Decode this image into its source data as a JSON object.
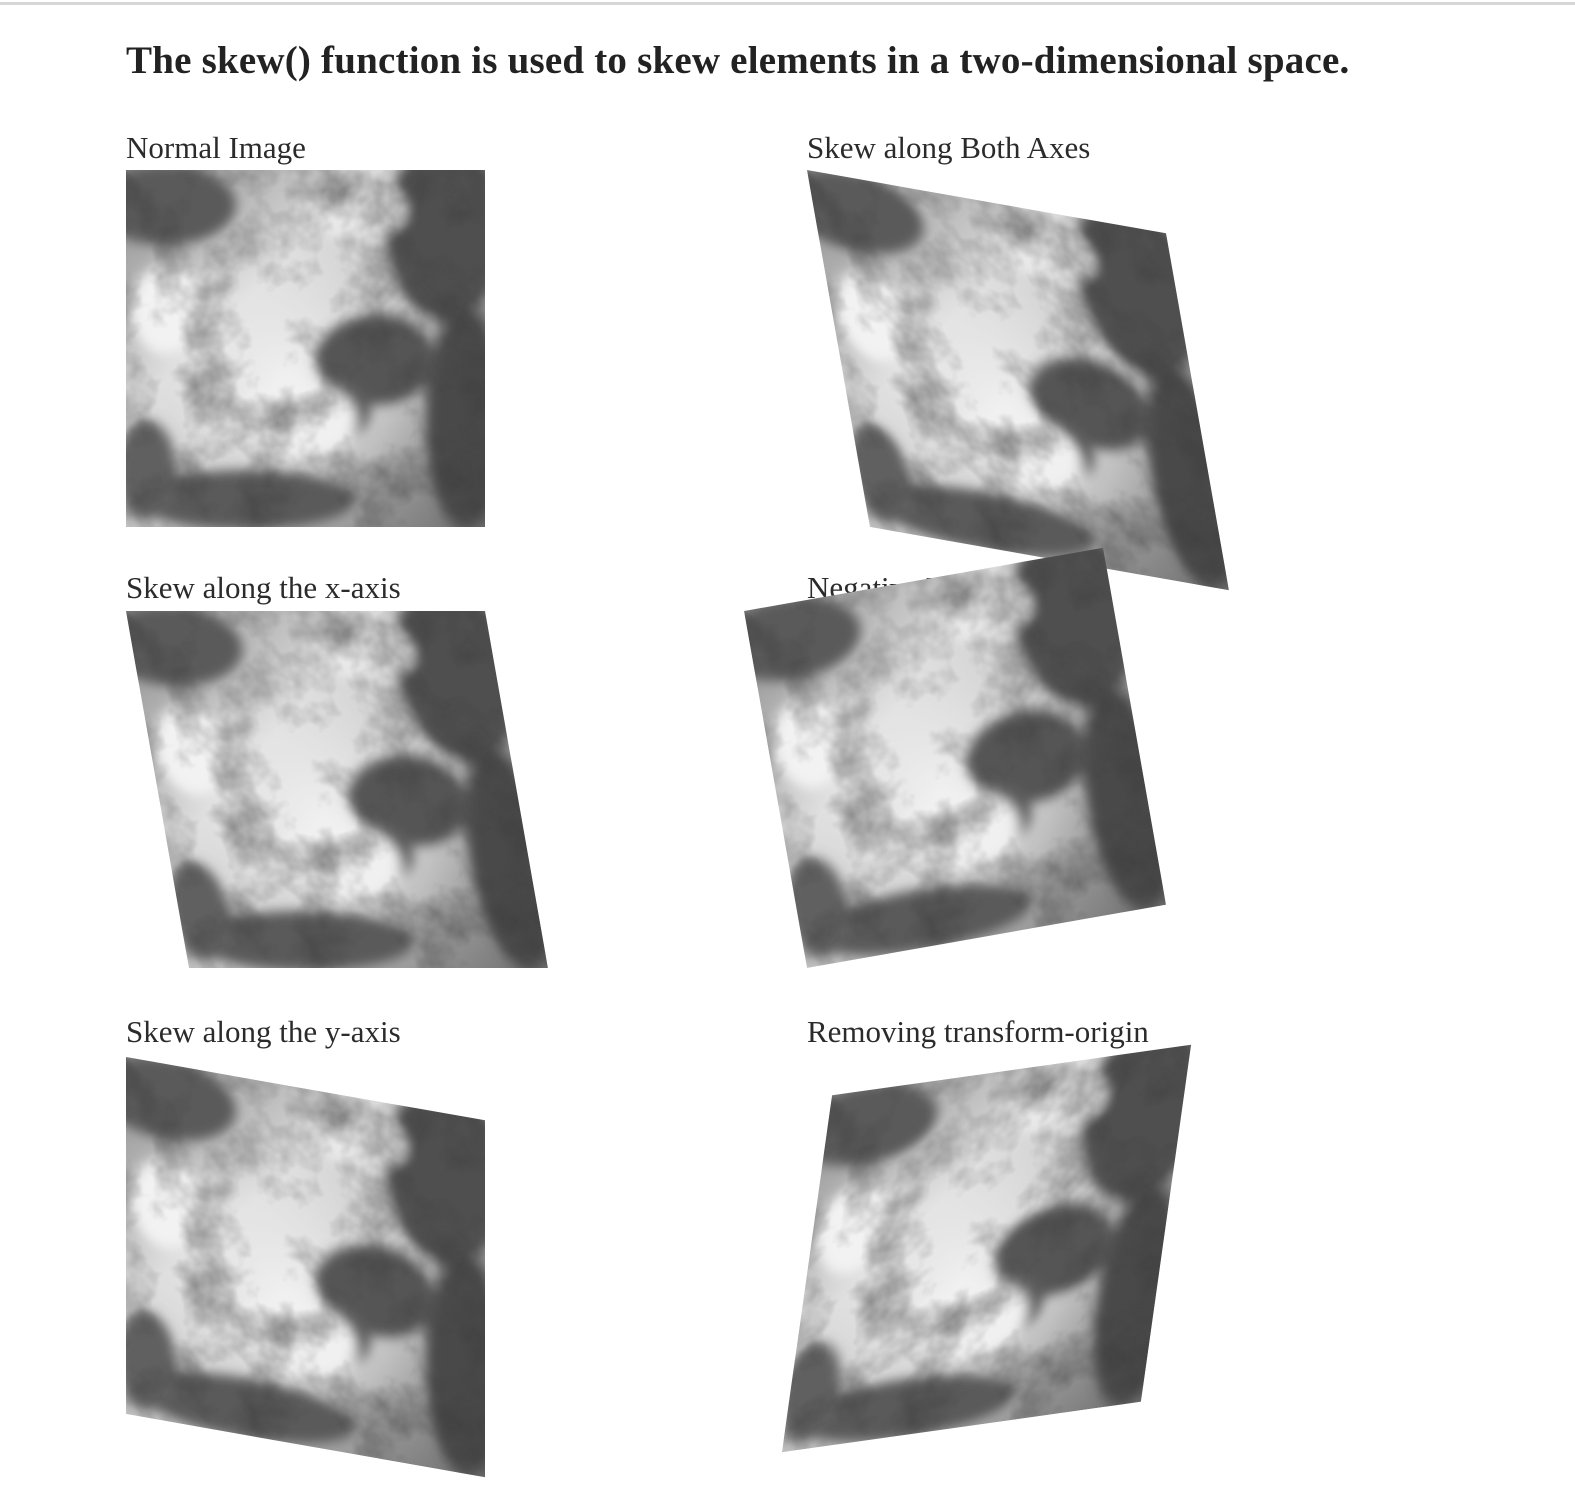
{
  "heading": "The skew() function is used to skew elements in a two-dimensional space.",
  "demos": {
    "normal": {
      "caption": "Normal Image"
    },
    "x_axis": {
      "caption": "Skew along the x-axis"
    },
    "y_axis": {
      "caption": "Skew along the y-axis"
    },
    "both_axes": {
      "caption": "Skew along Both Axes"
    },
    "negative": {
      "caption": "Negative Values"
    },
    "no_origin": {
      "caption": "Removing transform-origin"
    }
  },
  "colors": {
    "heading_text": "#222222",
    "caption_text": "#2b2b2b",
    "rule": "#d7d7d7",
    "sky_light": "#e6e6e6",
    "cloud_dark": "#4a4a4a"
  }
}
